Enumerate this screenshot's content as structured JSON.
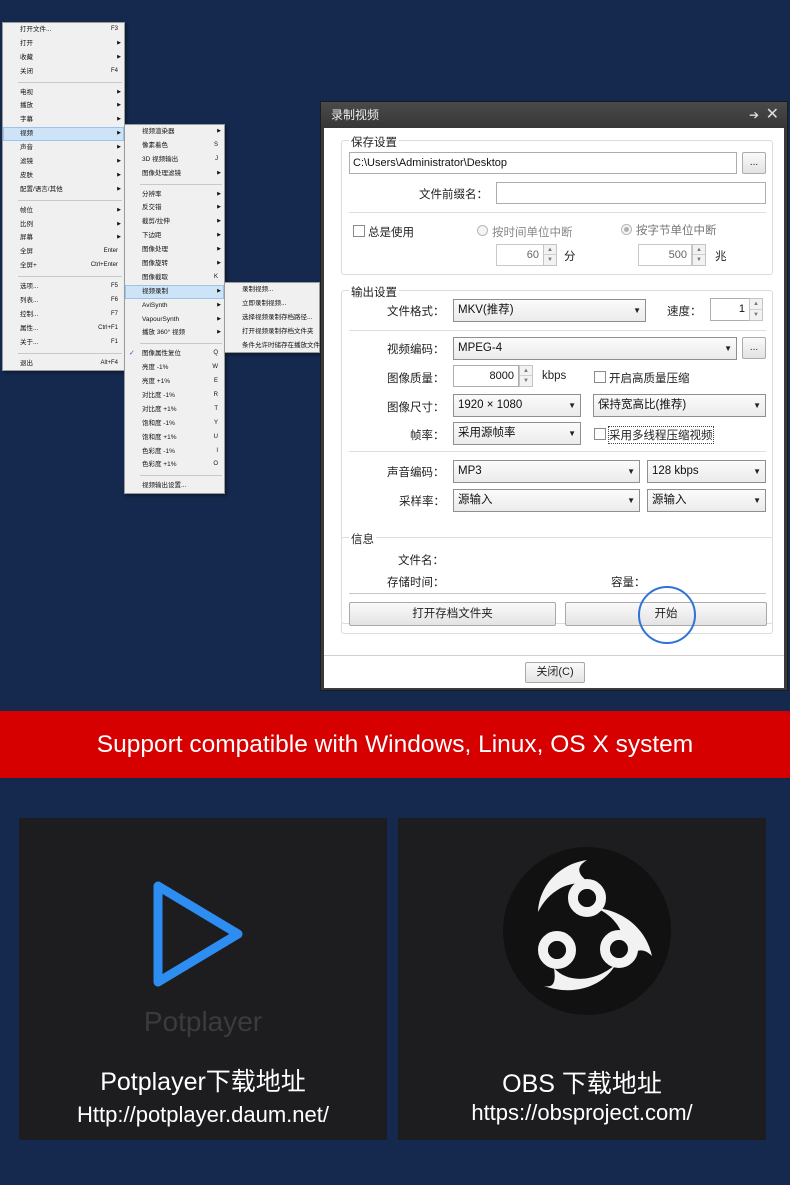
{
  "menu_main": {
    "items": [
      {
        "label": "打开文件...",
        "shortcut": "F3"
      },
      {
        "label": "打开",
        "arrow": true
      },
      {
        "label": "收藏",
        "arrow": true
      },
      {
        "label": "关闭",
        "shortcut": "F4"
      },
      {
        "sep": true
      },
      {
        "label": "电视",
        "arrow": true
      },
      {
        "label": "播放",
        "arrow": true
      },
      {
        "label": "字幕",
        "arrow": true
      },
      {
        "label": "视频",
        "arrow": true,
        "highlight": true
      },
      {
        "label": "声音",
        "arrow": true
      },
      {
        "label": "滤镜",
        "arrow": true
      },
      {
        "label": "皮肤",
        "arrow": true
      },
      {
        "label": "配置/语言/其他",
        "arrow": true
      },
      {
        "sep": true
      },
      {
        "label": "帧位",
        "arrow": true
      },
      {
        "label": "比例",
        "arrow": true
      },
      {
        "label": "屏幕",
        "arrow": true
      },
      {
        "label": "全屏",
        "shortcut": "Enter"
      },
      {
        "label": "全屏+",
        "shortcut": "Ctrl+Enter"
      },
      {
        "sep": true
      },
      {
        "label": "选项...",
        "shortcut": "F5"
      },
      {
        "label": "列表...",
        "shortcut": "F6"
      },
      {
        "label": "控制...",
        "shortcut": "F7"
      },
      {
        "label": "属性...",
        "shortcut": "Ctrl+F1"
      },
      {
        "label": "关于...",
        "shortcut": "F1"
      },
      {
        "sep": true
      },
      {
        "label": "退出",
        "shortcut": "Alt+F4"
      }
    ]
  },
  "menu_video": {
    "items": [
      {
        "label": "视频渲染器",
        "arrow": true
      },
      {
        "label": "像素着色",
        "shortcut": "S"
      },
      {
        "label": "3D 视频输出",
        "shortcut": "J"
      },
      {
        "label": "图像处理滤镜",
        "arrow": true
      },
      {
        "sep": true
      },
      {
        "label": "分辨率",
        "arrow": true
      },
      {
        "label": "反交错",
        "arrow": true
      },
      {
        "label": "截剪/拉伸",
        "arrow": true
      },
      {
        "label": "下边距",
        "arrow": true
      },
      {
        "label": "图像处理",
        "arrow": true
      },
      {
        "label": "图像旋转",
        "arrow": true
      },
      {
        "label": "图像截取",
        "shortcut": "K"
      },
      {
        "label": "视频录制",
        "arrow": true,
        "highlight": true
      },
      {
        "label": "AviSynth",
        "arrow": true
      },
      {
        "label": "VapourSynth",
        "arrow": true
      },
      {
        "label": "播放 360° 视频",
        "arrow": true
      },
      {
        "sep": true
      },
      {
        "label": "图像属性复位",
        "shortcut": "Q",
        "check": true
      },
      {
        "label": "亮度 -1%",
        "shortcut": "W"
      },
      {
        "label": "亮度 +1%",
        "shortcut": "E"
      },
      {
        "label": "对比度 -1%",
        "shortcut": "R"
      },
      {
        "label": "对比度 +1%",
        "shortcut": "T"
      },
      {
        "label": "饱和度 -1%",
        "shortcut": "Y"
      },
      {
        "label": "饱和度 +1%",
        "shortcut": "U"
      },
      {
        "label": "色彩度 -1%",
        "shortcut": "I"
      },
      {
        "label": "色彩度 +1%",
        "shortcut": "O"
      },
      {
        "sep": true
      },
      {
        "label": "视频输出设置..."
      }
    ]
  },
  "menu_record": {
    "items": [
      {
        "label": "录制视频..."
      },
      {
        "label": "立即录制视频..."
      },
      {
        "label": "选择视频录制存档路径..."
      },
      {
        "label": "打开视频录制存档文件夹"
      },
      {
        "label": "条件允许时储存在播放文件夹"
      }
    ]
  },
  "dialog": {
    "title": "录制视频",
    "save_group": "保存设置",
    "path": "C:\\Users\\Administrator\\Desktop",
    "browse": "...",
    "prefix_label": "文件前缀名：",
    "prefix_value": "",
    "always_use": "总是使用",
    "split_by_time": "按时间单位中断",
    "split_by_size": "按字节单位中断",
    "time_value": "60",
    "time_unit": "分",
    "size_value": "500",
    "size_unit": "兆",
    "output_group": "输出设置",
    "format_label": "文件格式：",
    "format_value": "MKV(推荐)",
    "speed_label": "速度：",
    "speed_value": "1",
    "vcodec_label": "视频编码：",
    "vcodec_value": "MPEG-4",
    "vcodec_btn": "...",
    "quality_label": "图像质量：",
    "quality_value": "8000",
    "quality_unit": "kbps",
    "hq_label": "开启高质量压缩",
    "size_label": "图像尺寸：",
    "size_select": "1920 × 1080",
    "aspect_select": "保持宽高比(推荐)",
    "fps_label": "帧率：",
    "fps_value": "采用源帧率",
    "mt_label": "采用多线程压缩视频",
    "acodec_label": "声音编码：",
    "acodec_value": "MP3",
    "abitrate_value": "128 kbps",
    "samplerate_label": "采样率：",
    "samplerate_value": "源输入",
    "channels_value": "源输入",
    "info_group": "信息",
    "filename_label": "文件名：",
    "storetime_label": "存储时间：",
    "capacity_label": "容量：",
    "open_folder_btn": "打开存档文件夹",
    "start_btn": "开始",
    "close_btn": "关闭(C)"
  },
  "banner": {
    "text": "Support compatible with Windows, Linux, OS X system"
  },
  "cards": {
    "potplayer": {
      "watermark": "Potplayer",
      "title": "Potplayer下载地址",
      "url": "Http://potplayer.daum.net/",
      "accent": "#2d8df0"
    },
    "obs": {
      "title": "OBS  下载地址",
      "url": "https://obsproject.com/"
    }
  },
  "colors": {
    "background": "#14294d",
    "banner": "#d60000",
    "card": "#1d1d1f"
  }
}
